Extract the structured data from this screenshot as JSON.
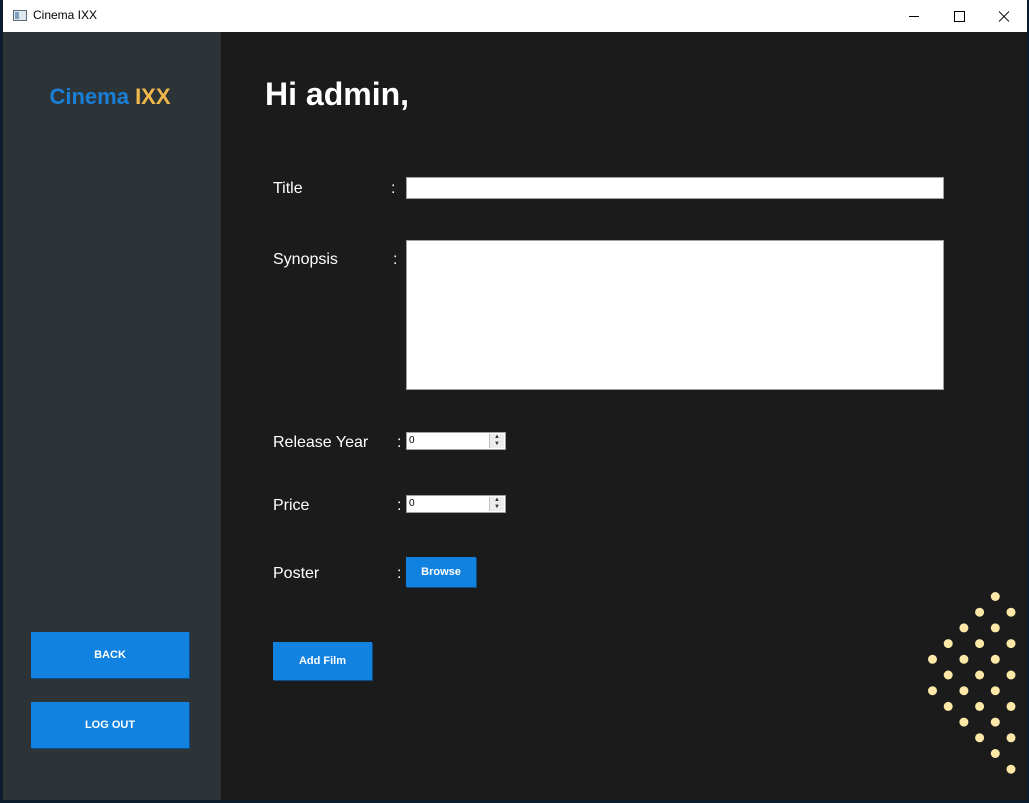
{
  "window": {
    "title": "Cinema IXX"
  },
  "sidebar": {
    "logo_part1": "Cinema",
    "logo_part2": "IXX",
    "back_label": "BACK",
    "logout_label": "LOG OUT"
  },
  "main": {
    "heading": "Hi admin,",
    "colon": ":",
    "title_label": "Title",
    "title_value": "",
    "synopsis_label": "Synopsis",
    "synopsis_value": "",
    "release_year_label": "Release Year",
    "release_year_value": "0",
    "price_label": "Price",
    "price_value": "0",
    "poster_label": "Poster",
    "browse_label": "Browse",
    "add_film_label": "Add Film"
  },
  "colors": {
    "accent_blue": "#1282e0",
    "logo_blue": "#1a7fd6",
    "logo_gold": "#f0b84b",
    "dot_color": "#fde8a8",
    "sidebar_bg": "#2c3437",
    "content_bg": "#1b1b1b"
  },
  "icons": [
    "app-icon",
    "minimize-icon",
    "maximize-icon",
    "close-icon",
    "spin-up-icon",
    "spin-down-icon"
  ]
}
